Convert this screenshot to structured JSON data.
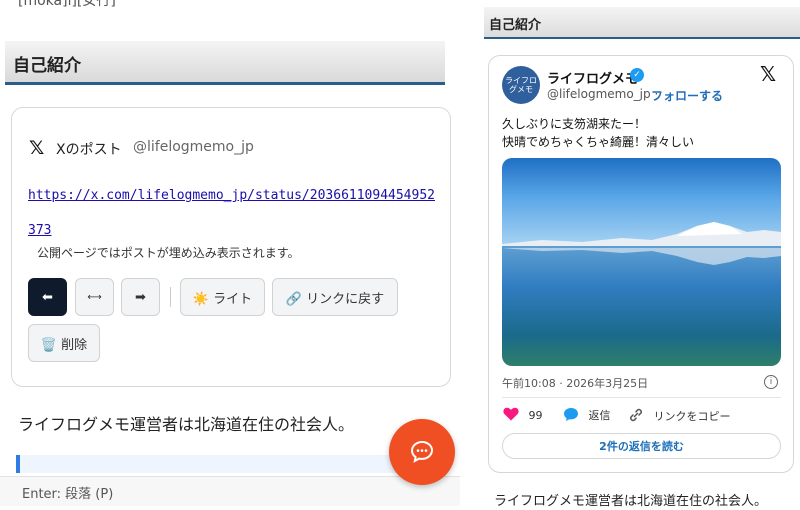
{
  "editor": {
    "clipped_top_text": "[moka]i][女行]",
    "section_title": "自己紹介",
    "embed": {
      "x_logo": "𝕏",
      "post_label": "Xのポスト",
      "handle": "@lifelogmemo_jp",
      "url": "https://x.com/lifelogmemo_jp/status/2036611094454952373",
      "notice": "公開ページではポストが埋め込み表示されます。",
      "buttons": {
        "left": "⬅",
        "center": "⟷",
        "right": "➡",
        "light": "☀️ ライト",
        "back_to_link": "🔗 リンクに戻す",
        "delete": "🗑️ 削除"
      }
    },
    "body_text": "ライフログメモ運営者は北海道在住の社会人。",
    "status_hint": "Enter: 段落 (P)"
  },
  "preview": {
    "section_title": "自己紹介",
    "tweet": {
      "avatar_text": "ライフログメモ",
      "author_name": "ライフログメモ",
      "verified_mark": "✓",
      "handle": "@lifelogmemo_jp",
      "separator": "·",
      "follow_label": "フォローする",
      "x_logo": "𝕏",
      "text_line1": "久しぶりに支笏湖来たー！",
      "text_line2": "快晴でめちゃくちゃ綺麗！清々しい",
      "timestamp": "午前10:08 · 2026年3月25日",
      "info_icon": "i",
      "like_count": "99",
      "reply_label": "返信",
      "copy_link_label": "リンクをコピー",
      "read_replies_label": "2件の返信を読む"
    },
    "body_text": "ライフログメモ運営者は北海道在住の社会人。"
  },
  "colors": {
    "accent_blue": "#1d6fb8",
    "fab_orange": "#f04e23",
    "dark_button": "#0f1b2d",
    "heart": "#f91880",
    "section_rule": "#2b5d8a"
  },
  "icons": {
    "fab": "chat-bubble-icon",
    "like": "heart-icon",
    "reply": "speech-bubble-icon",
    "copy": "link-icon"
  }
}
